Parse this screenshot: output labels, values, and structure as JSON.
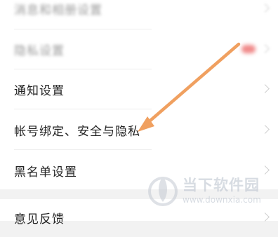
{
  "settings": {
    "rows": [
      {
        "label": "消息和相册设置",
        "blurred": true
      },
      {
        "label": "隐私设置",
        "blurred": true
      },
      {
        "label": "通知设置",
        "blurred": false
      },
      {
        "label": "帐号绑定、安全与隐私",
        "blurred": false
      },
      {
        "label": "黑名单设置",
        "blurred": false
      }
    ],
    "feedback_label": "意见反馈"
  },
  "watermark": {
    "title": "当下软件园",
    "url": "www.downxia.com"
  },
  "colors": {
    "arrow": "#f0a060",
    "badge": "#f08a8a"
  }
}
